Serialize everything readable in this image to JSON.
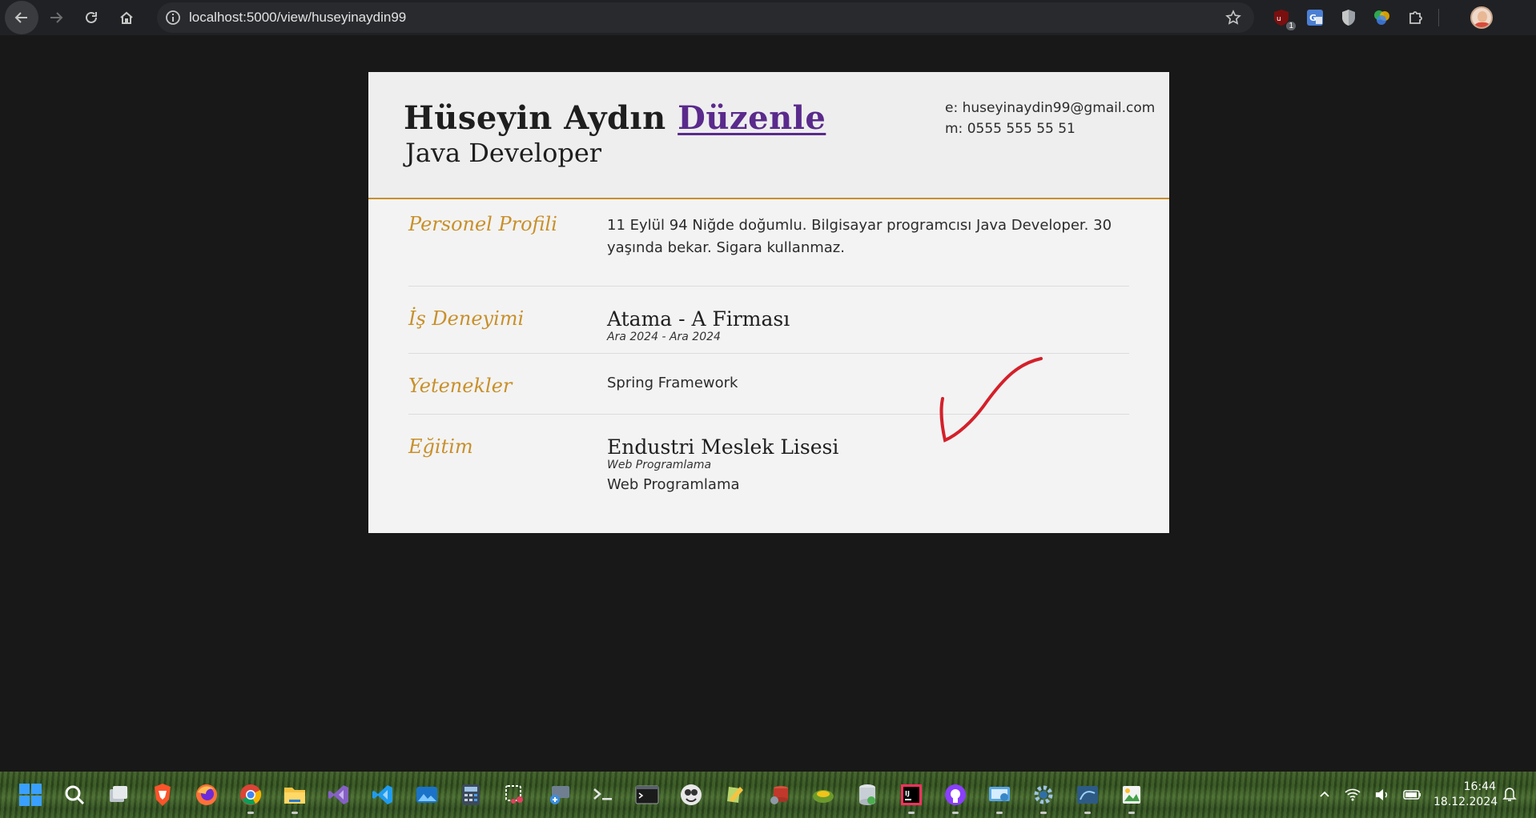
{
  "browser": {
    "url": "localhost:5000/view/huseyinaydin99",
    "extension_badge": "1",
    "icons": [
      "back-icon",
      "forward-icon",
      "reload-icon",
      "home-icon",
      "site-info-icon",
      "bookmark-star-icon",
      "ublock-icon",
      "google-translate-icon",
      "shield-extension-icon",
      "colorful-extension-icon",
      "extensions-puzzle-icon",
      "profile-avatar"
    ]
  },
  "resume": {
    "name": "Hüseyin Aydın",
    "edit_link": "Düzenle",
    "title": "Java Developer",
    "email": "e: huseyinaydin99@gmail.com",
    "phone": "m: 0555 555 55 51",
    "sections": {
      "profile": {
        "label": "Personel Profili",
        "text": "11 Eylül 94 Niğde doğumlu. Bilgisayar programcısı Java Developer. 30 yaşında bekar. Sigara kullanmaz."
      },
      "experience": {
        "label": "İş Deneyimi",
        "title": "Atama - A Firması",
        "dates": "Ara 2024 - Ara 2024"
      },
      "skills": {
        "label": "Yetenekler",
        "item": "Spring Framework"
      },
      "education": {
        "label": "Eğitim",
        "school": "Endustri Meslek Lisesi",
        "field": "Web Programlama",
        "description": "Web Programlama"
      }
    }
  },
  "colors": {
    "accent": "#c8902a",
    "link": "#5a2a8c",
    "annotation": "#d4202a",
    "page_bg": "#181818",
    "card_bg": "#f3f3f3"
  },
  "taskbar": {
    "icons": [
      "windows-start-icon",
      "search-icon",
      "task-view-icon",
      "brave-icon",
      "firefox-icon",
      "chrome-icon",
      "file-explorer-icon",
      "visual-studio-icon",
      "vscode-icon",
      "photos-icon",
      "calculator-icon",
      "snipping-tool-icon",
      "remote-desktop-icon",
      "terminal-icon",
      "console-icon",
      "cmd-app-icon",
      "notepad-plus-icon",
      "database-tool-icon",
      "snake-app-icon",
      "sql-server-icon",
      "intellij-idea-icon",
      "github-desktop-icon",
      "control-panel-icon",
      "settings-icon",
      "mysql-workbench-icon",
      "paint-icon"
    ],
    "time": "16:44",
    "date": "18.12.2024"
  }
}
